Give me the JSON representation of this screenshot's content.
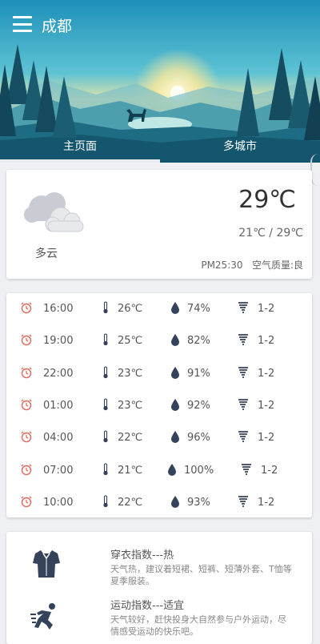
{
  "header": {
    "city": "成都",
    "tabs": [
      "主页面",
      "多城市"
    ]
  },
  "current": {
    "condition": "多云",
    "temperature": "29℃",
    "range": "21℃ / 29℃",
    "pm25": "PM25:30",
    "air_quality": "空气质量:良"
  },
  "hourly": [
    {
      "time": "16:00",
      "temp": "26℃",
      "humidity": "74%",
      "wind": "1-2"
    },
    {
      "time": "19:00",
      "temp": "25℃",
      "humidity": "82%",
      "wind": "1-2"
    },
    {
      "time": "22:00",
      "temp": "23℃",
      "humidity": "91%",
      "wind": "1-2"
    },
    {
      "time": "01:00",
      "temp": "23℃",
      "humidity": "92%",
      "wind": "1-2"
    },
    {
      "time": "04:00",
      "temp": "22℃",
      "humidity": "96%",
      "wind": "1-2"
    },
    {
      "time": "07:00",
      "temp": "21℃",
      "humidity": "100%",
      "wind": "1-2"
    },
    {
      "time": "10:00",
      "temp": "22℃",
      "humidity": "93%",
      "wind": "1-2"
    }
  ],
  "life": [
    {
      "title": "穿衣指数---热",
      "desc": "天气热，建议着短裙、短裤、短薄外套、T恤等夏季服装。",
      "icon": "shirt-icon"
    },
    {
      "title": "运动指数---适宜",
      "desc": "天气较好，赶快投身大自然参与户外运动，尽情感受运动的快乐吧。",
      "icon": "running-icon"
    }
  ],
  "colors": {
    "alarm": "#e2685a",
    "dark_icon": "#34435a"
  }
}
